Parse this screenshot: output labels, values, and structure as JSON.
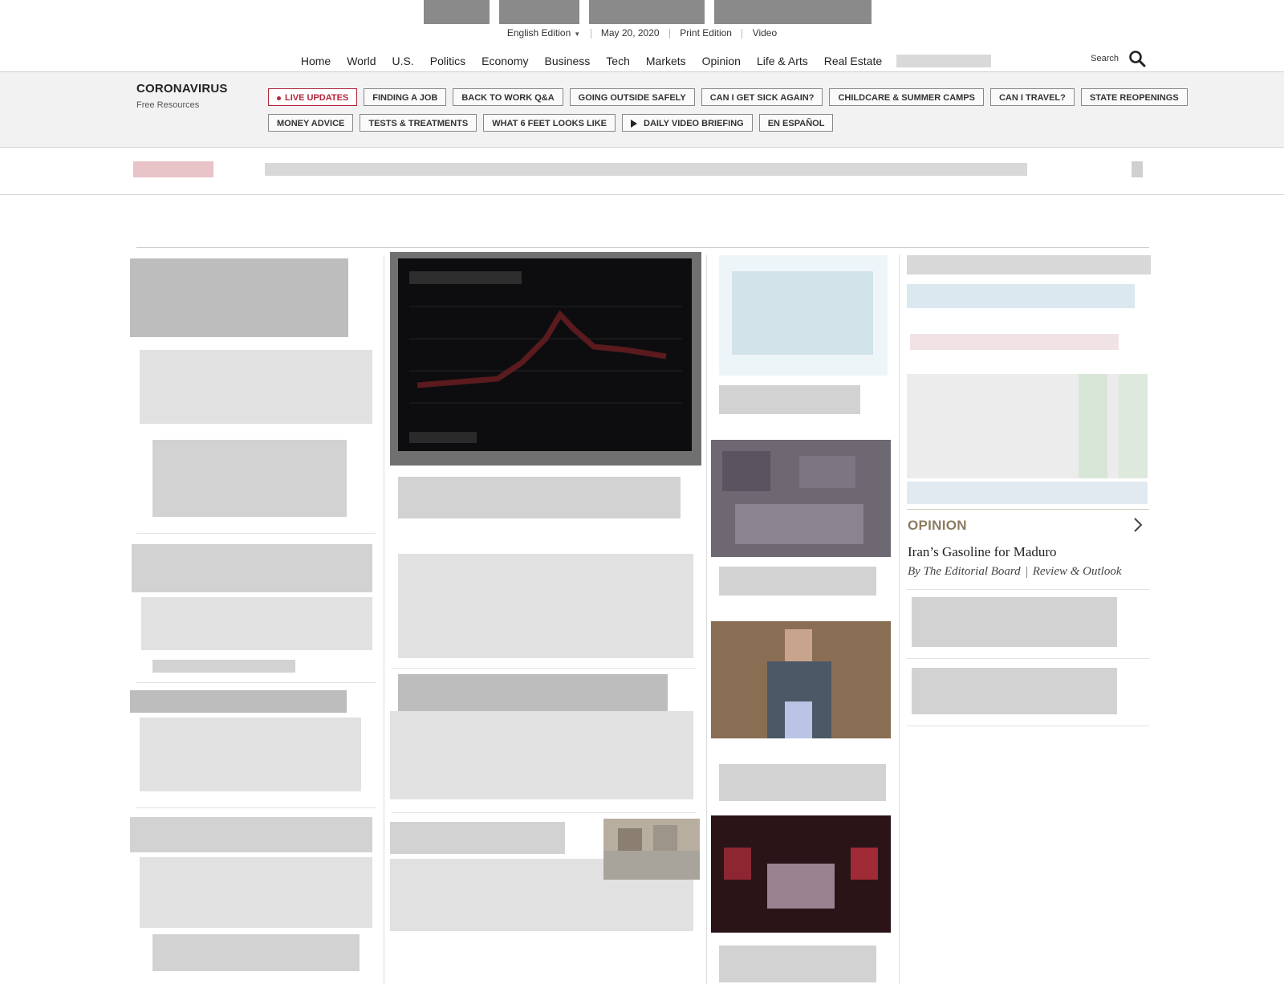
{
  "subnav": {
    "edition": "English Edition",
    "date": "May 20, 2020",
    "print_edition": "Print Edition",
    "video": "Video"
  },
  "mainnav": {
    "items": [
      "Home",
      "World",
      "U.S.",
      "Politics",
      "Economy",
      "Business",
      "Tech",
      "Markets",
      "Opinion",
      "Life & Arts",
      "Real Estate"
    ]
  },
  "search": {
    "label": "Search"
  },
  "coronavirus": {
    "title": "CORONAVIRUS",
    "subtitle": "Free Resources",
    "row1": [
      "LIVE UPDATES",
      "FINDING A JOB",
      "BACK TO WORK Q&A",
      "GOING OUTSIDE SAFELY",
      "CAN I GET SICK AGAIN?",
      "CHILDCARE & SUMMER CAMPS",
      "CAN I TRAVEL?",
      "STATE REOPENINGS"
    ],
    "row2": [
      "MONEY ADVICE",
      "TESTS & TREATMENTS",
      "WHAT 6 FEET LOOKS LIKE",
      "DAILY VIDEO BRIEFING",
      "EN ESPAÑOL"
    ]
  },
  "opinion": {
    "label": "OPINION",
    "headline": "Iran’s Gasoline for Maduro",
    "author": "By The Editorial Board",
    "section": "Review & Outlook"
  },
  "colors": {
    "live_accent": "#b3253a",
    "opinion_accent": "#8b7b62",
    "covid_bar_bg": "#f2f2f2"
  }
}
